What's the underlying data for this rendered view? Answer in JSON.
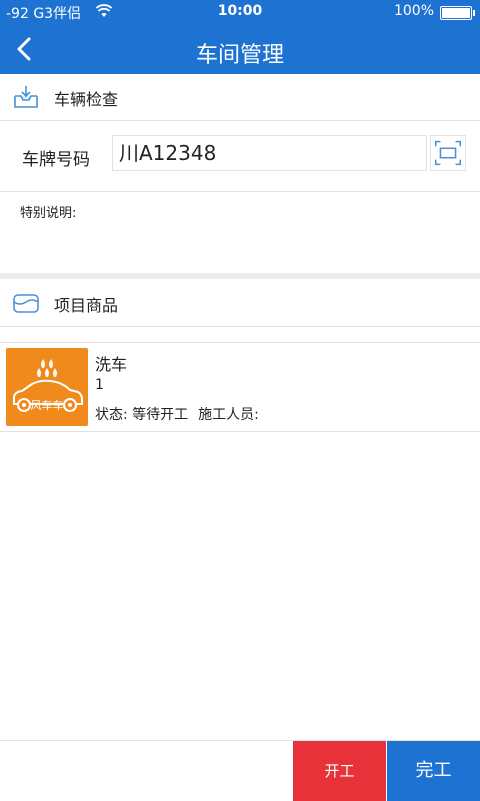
{
  "status_bar": {
    "carrier": "-92 G3伴侣",
    "time": "10:00",
    "battery": "100%",
    "battery_level": 1.0
  },
  "nav": {
    "title": "车间管理",
    "back_icon": "chevron-left-icon"
  },
  "vehicle_section": {
    "title": "车辆检查",
    "icon": "inbox-download-icon"
  },
  "plate": {
    "label": "车牌号码",
    "value": "川A12348",
    "scan_icon": "scan-frame-icon"
  },
  "remark": {
    "label": "特别说明:"
  },
  "items_section": {
    "title": "项目商品",
    "icon": "tray-icon"
  },
  "products": [
    {
      "name": "洗车",
      "quantity": "1",
      "status": "状态: 等待开工",
      "staff": "施工人员:",
      "thumb_text": "风车车",
      "thumb_color": "#f08a1c"
    }
  ],
  "actions": {
    "start_label": "开工",
    "finish_label": "完工",
    "start_color": "#e8323a",
    "finish_color": "#1e73d2"
  },
  "colors": {
    "primary": "#1e73d2",
    "divider": "#e2e2e2"
  }
}
